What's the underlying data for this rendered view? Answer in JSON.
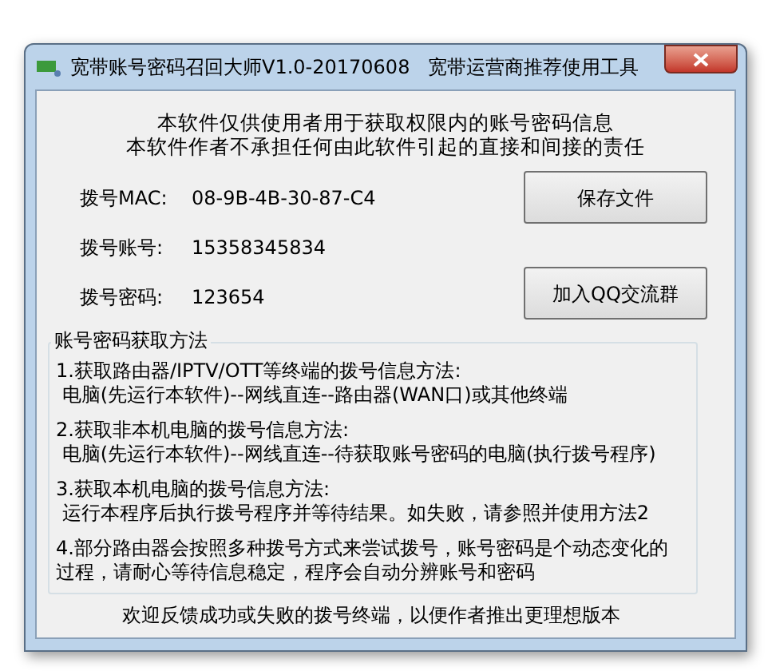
{
  "window": {
    "title": "宽带账号密码召回大师V1.0-20170608   宽带运营商推荐使用工具"
  },
  "notice": [
    "本软件仅供使用者用于获取权限内的账号密码信息",
    "本软件作者不承担任何由此软件引起的直接和间接的责任"
  ],
  "fields": [
    {
      "label": "拨号MAC:",
      "value": "08-9B-4B-30-87-C4"
    },
    {
      "label": "拨号账号:",
      "value": "15358345834"
    },
    {
      "label": "拨号密码:",
      "value": "123654"
    }
  ],
  "buttons": [
    "保存文件",
    "加入QQ交流群"
  ],
  "methods_group": {
    "legend": "账号密码获取方法",
    "items": [
      {
        "lines": [
          "1.获取路由器/IPTV/OTT等终端的拨号信息方法:",
          " 电脑(先运行本软件)--网线直连--路由器(WAN口)或其他终端"
        ]
      },
      {
        "lines": [
          "2.获取非本机电脑的拨号信息方法:",
          " 电脑(先运行本软件)--网线直连--待获取账号密码的电脑(执行拨号程序)"
        ]
      },
      {
        "lines": [
          "3.获取本机电脑的拨号信息方法:",
          " 运行本程序后执行拨号程序并等待结果。如失败，请参照并使用方法2"
        ]
      },
      {
        "lines": [
          "4.部分路由器会按照多种拨号方式来尝试拨号，账号密码是个动态变化的",
          "过程，请耐心等待信息稳定，程序会自动分辨账号和密码"
        ]
      }
    ]
  },
  "footer": "欢迎反馈成功或失败的拨号终端，以便作者推出更理想版本"
}
